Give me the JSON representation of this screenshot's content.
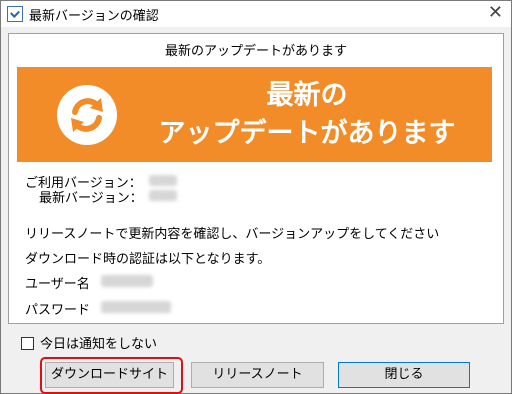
{
  "window": {
    "title": "最新バージョンの確認"
  },
  "panel": {
    "headline": "最新のアップデートがあります"
  },
  "banner": {
    "line1": "最新の",
    "line2": "アップデートがあります",
    "bg_color": "#f28c28",
    "icon": "refresh-icon"
  },
  "versions": {
    "current_label": "ご利用バージョン：",
    "latest_label": "最新バージョン："
  },
  "message": {
    "line1": "リリースノートで更新内容を確認し、バージョンアップをしてください",
    "line2": "ダウンロード時の認証は以下となります。"
  },
  "credentials": {
    "user_label": "ユーザー名",
    "password_label": "パスワード"
  },
  "options": {
    "do_not_notify_label": "今日は通知をしない"
  },
  "buttons": {
    "download": "ダウンロードサイト",
    "release_notes": "リリースノート",
    "close": "閉じる"
  }
}
